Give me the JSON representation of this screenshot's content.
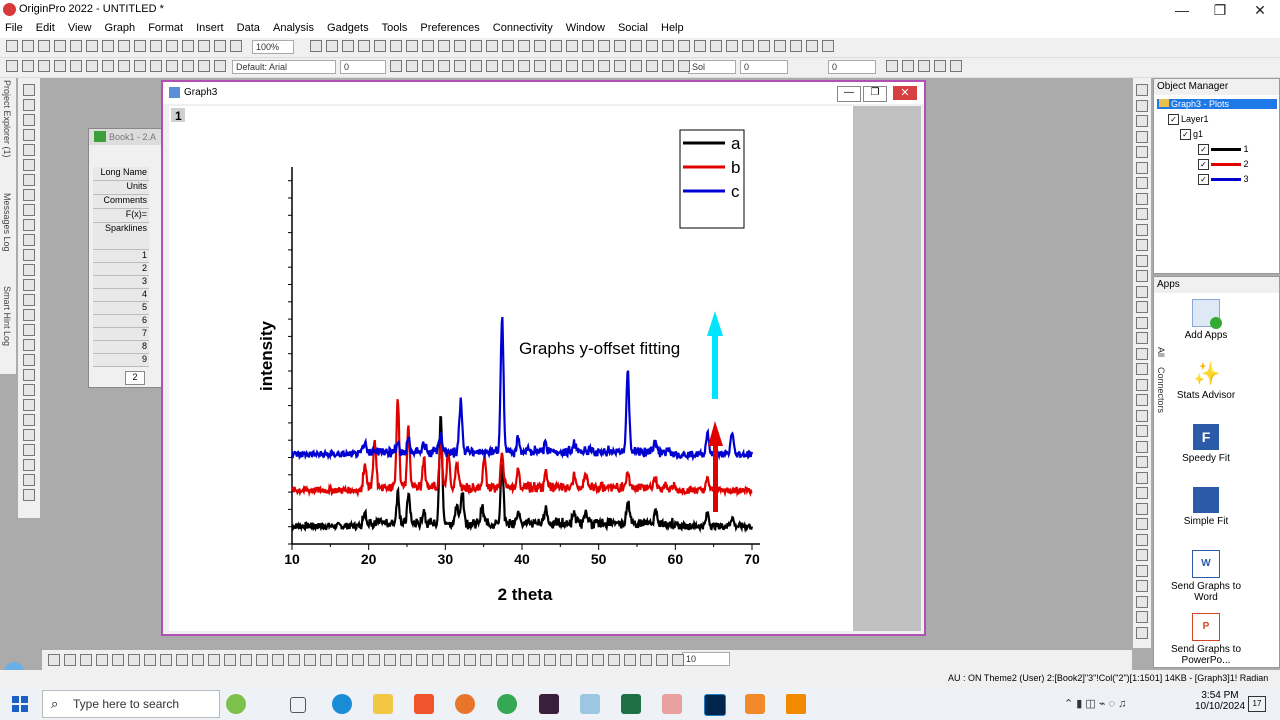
{
  "window": {
    "title": "OriginPro 2022 - UNTITLED *",
    "min": "—",
    "max": "❐",
    "close": "✕"
  },
  "menu": [
    "File",
    "Edit",
    "View",
    "Graph",
    "Format",
    "Insert",
    "Data",
    "Analysis",
    "Gadgets",
    "Tools",
    "Preferences",
    "Connectivity",
    "Window",
    "Social",
    "Help"
  ],
  "toolbar": {
    "zoom": "100%",
    "font": "Default: Arial",
    "fontsize": "0",
    "linestyle": "Sol",
    "linewidth": "0",
    "fill": "0",
    "bottom_value": "10"
  },
  "dock_tabs": {
    "project_explorer": "Project Explorer (1)",
    "messages": "Messages Log",
    "smart_hint": "Smart Hint Log"
  },
  "book": {
    "title": "Book1 - 2.A",
    "labels": [
      "Long Name",
      "Units",
      "Comments",
      "F(x)=",
      "Sparklines"
    ],
    "rows": [
      "1",
      "2",
      "3",
      "4",
      "5",
      "6",
      "7",
      "8",
      "9"
    ],
    "sheet_tab": "2"
  },
  "graph": {
    "window_title": "Graph3",
    "layer_badge": "1",
    "annotation": "Graphs y-offset fitting",
    "legend": [
      {
        "label": "a",
        "color": "#000000"
      },
      {
        "label": "b",
        "color": "#e00000"
      },
      {
        "label": "c",
        "color": "#0000d0"
      }
    ],
    "arrow_up_color": "#00e5ff",
    "arrow_red_color": "#e00000"
  },
  "chart_data": {
    "type": "line",
    "xlabel": "2 theta",
    "ylabel": "intensity",
    "xlim": [
      10,
      70
    ],
    "xticks": [
      "10",
      "20",
      "30",
      "40",
      "50",
      "60",
      "70"
    ],
    "series": [
      {
        "name": "a",
        "color": "#000000",
        "baseline": 0,
        "peaks": [
          [
            19.5,
            12
          ],
          [
            23.8,
            28
          ],
          [
            25.2,
            26
          ],
          [
            27.2,
            12
          ],
          [
            29.4,
            100
          ],
          [
            31.5,
            15
          ],
          [
            32.2,
            30
          ],
          [
            34.8,
            14
          ],
          [
            37.4,
            50
          ],
          [
            39.5,
            12
          ],
          [
            43.1,
            15
          ],
          [
            46.8,
            10
          ],
          [
            48.3,
            12
          ],
          [
            53.8,
            22
          ],
          [
            57.4,
            10
          ],
          [
            64.2,
            12
          ],
          [
            67.4,
            8
          ]
        ]
      },
      {
        "name": "b",
        "color": "#e00000",
        "baseline": 32,
        "peaks": [
          [
            19.5,
            20
          ],
          [
            20.8,
            42
          ],
          [
            23.8,
            78
          ],
          [
            25.2,
            52
          ],
          [
            27.2,
            26
          ],
          [
            29.4,
            40
          ],
          [
            30.4,
            33
          ],
          [
            31.5,
            22
          ],
          [
            35.1,
            30
          ],
          [
            37.4,
            30
          ],
          [
            39.5,
            14
          ],
          [
            43.1,
            14
          ],
          [
            46.8,
            10
          ],
          [
            48.3,
            12
          ],
          [
            53.8,
            12
          ],
          [
            57.4,
            8
          ],
          [
            64.2,
            10
          ]
        ]
      },
      {
        "name": "c",
        "color": "#0000d0",
        "baseline": 64,
        "peaks": [
          [
            19.5,
            8
          ],
          [
            23.8,
            8
          ],
          [
            25.2,
            10
          ],
          [
            27.2,
            8
          ],
          [
            29.4,
            14
          ],
          [
            32.0,
            45
          ],
          [
            37.4,
            120
          ],
          [
            39.5,
            10
          ],
          [
            43.1,
            8
          ],
          [
            46.8,
            8
          ],
          [
            53.8,
            70
          ],
          [
            57.4,
            8
          ],
          [
            64.2,
            20
          ],
          [
            67.4,
            20
          ]
        ]
      }
    ]
  },
  "object_manager": {
    "title": "Object Manager",
    "root": "Graph3 - Plots",
    "layer": "Layer1",
    "group": "g1",
    "plots": [
      {
        "label": "1",
        "color": "#000000"
      },
      {
        "label": "2",
        "color": "#e00000"
      },
      {
        "label": "3",
        "color": "#0000d0"
      }
    ]
  },
  "apps": {
    "title": "Apps",
    "tabs": [
      "All",
      "Connectors"
    ],
    "items": [
      "Add Apps",
      "Stats Advisor",
      "Speedy Fit",
      "Simple Fit",
      "Send Graphs to Word",
      "Send Graphs to PowerPo..."
    ]
  },
  "status": {
    "text": "AU : ON  Theme2 (User)  2:[Book2]\"3\"!Col(\"2\")[1:1501]  14KB - [Graph3]1!  Radian"
  },
  "taskbar": {
    "search_placeholder": "Type here to search",
    "time": "3:54 PM",
    "date": "10/10/2024",
    "notifications": "17"
  }
}
